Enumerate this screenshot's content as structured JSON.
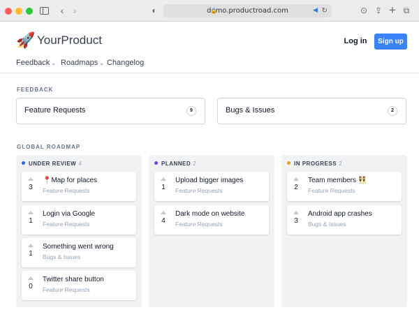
{
  "browser": {
    "url": "demo.productroad.com"
  },
  "header": {
    "brand": "YourProduct",
    "login_label": "Log in",
    "signup_label": "Sign up",
    "nav": [
      {
        "label": "Feedback",
        "dropdown": true
      },
      {
        "label": "Roadmaps",
        "dropdown": true
      },
      {
        "label": "Changelog",
        "dropdown": false
      }
    ]
  },
  "feedback": {
    "label": "FEEDBACK",
    "boards": [
      {
        "name": "Feature Requests",
        "count": "9"
      },
      {
        "name": "Bugs & Issues",
        "count": "2"
      }
    ]
  },
  "roadmap": {
    "label": "GLOBAL ROADMAP",
    "columns": [
      {
        "name": "UNDER REVIEW",
        "count": "4",
        "color": "#2563eb",
        "cards": [
          {
            "votes": "3",
            "title": "📍Map for places",
            "category": "Feature Requests"
          },
          {
            "votes": "1",
            "title": "Login via Google",
            "category": "Feature Requests"
          },
          {
            "votes": "1",
            "title": "Something went wrong",
            "category": "Bugs & Issues"
          },
          {
            "votes": "0",
            "title": "Twitter share button",
            "category": "Feature Requests"
          }
        ]
      },
      {
        "name": "PLANNED",
        "count": "2",
        "color": "#7c3aed",
        "cards": [
          {
            "votes": "1",
            "title": "Upload bigger images",
            "category": "Feature Requests"
          },
          {
            "votes": "4",
            "title": "Dark mode on website",
            "category": "Feature Requests"
          }
        ]
      },
      {
        "name": "IN PROGRESS",
        "count": "2",
        "color": "#f59e0b",
        "cards": [
          {
            "votes": "2",
            "title": "Team members 👯",
            "category": "Feature Requests"
          },
          {
            "votes": "3",
            "title": "Android app crashes",
            "category": "Bugs & Issues"
          }
        ]
      }
    ]
  }
}
